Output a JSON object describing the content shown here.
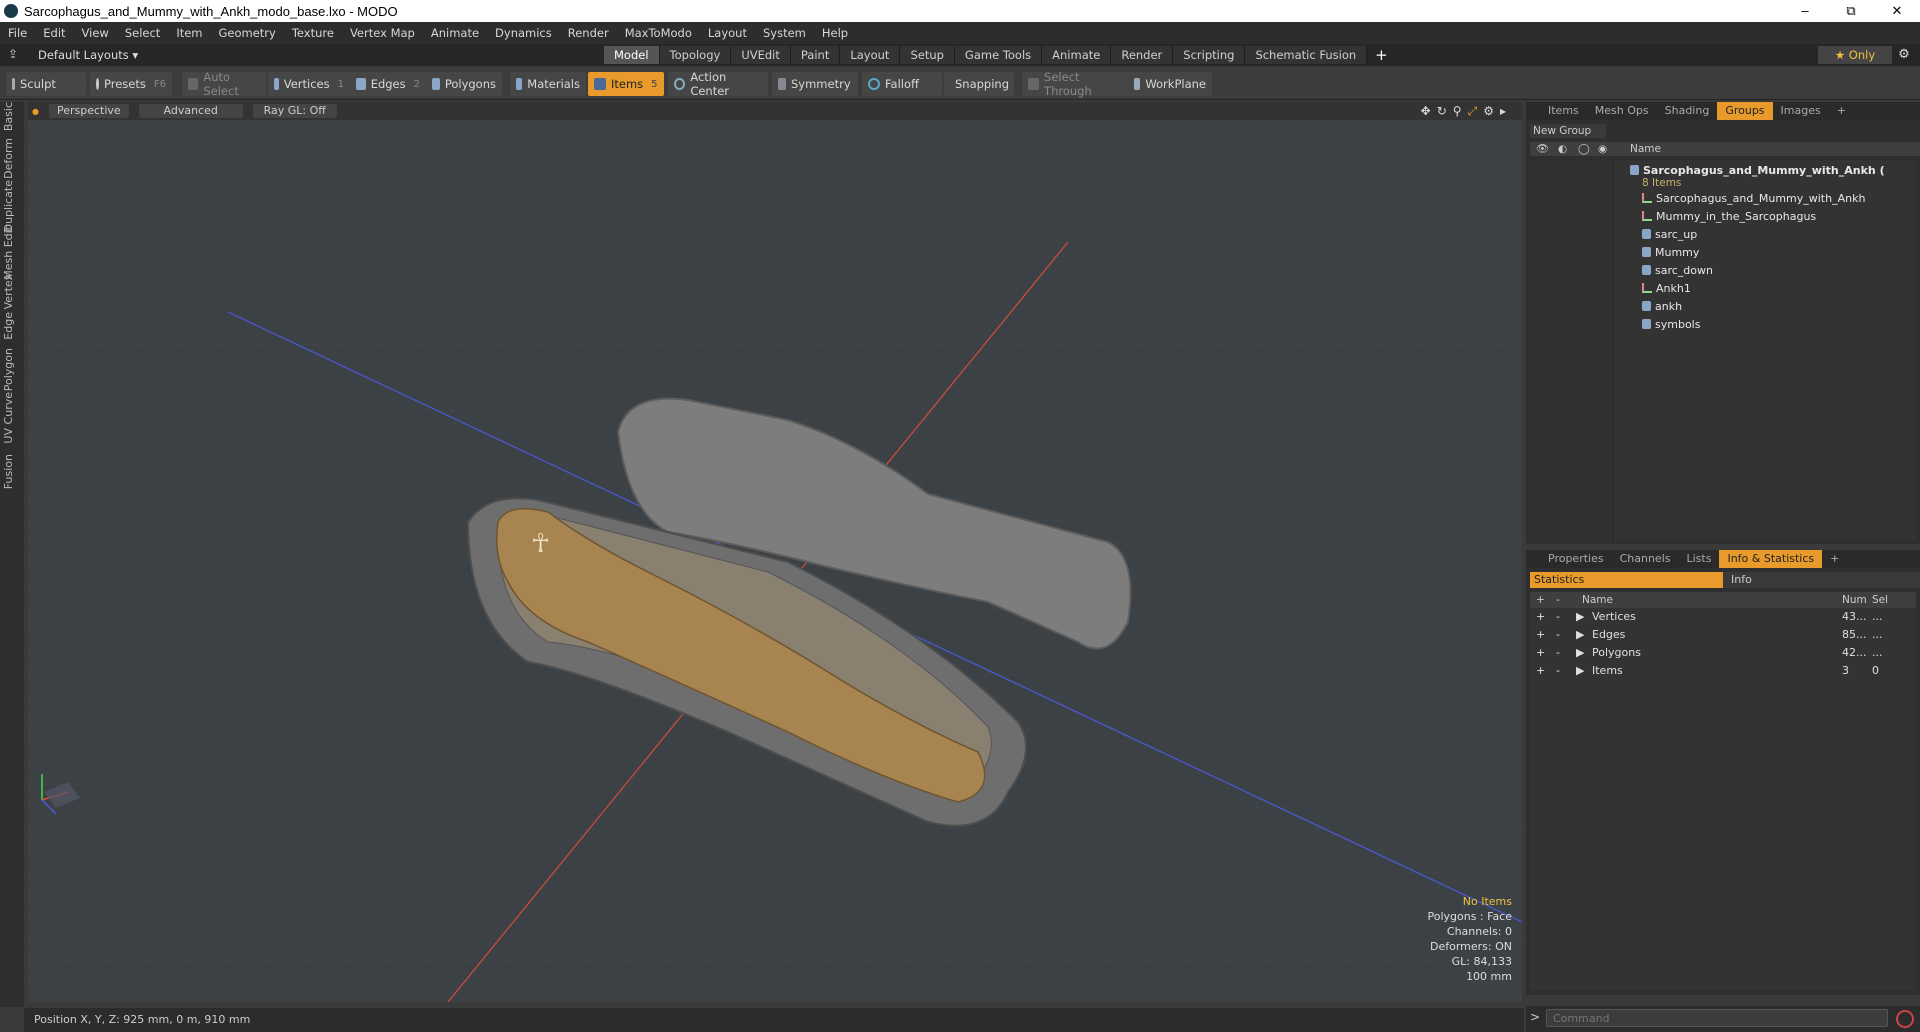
{
  "window": {
    "title": "Sarcophagus_and_Mummy_with_Ankh_modo_base.lxo - MODO",
    "minimize": "–",
    "maximize": "⧉",
    "close": "✕"
  },
  "menu": [
    "File",
    "Edit",
    "View",
    "Select",
    "Item",
    "Geometry",
    "Texture",
    "Vertex Map",
    "Animate",
    "Dynamics",
    "Render",
    "MaxToModo",
    "Layout",
    "System",
    "Help"
  ],
  "layouts": {
    "dropdown": "Default Layouts ▾",
    "only": "★  Only"
  },
  "layout_tabs": [
    "Model",
    "Topology",
    "UVEdit",
    "Paint",
    "Layout",
    "Setup",
    "Game Tools",
    "Animate",
    "Render",
    "Scripting",
    "Schematic Fusion"
  ],
  "toolbar": {
    "sculpt": "Sculpt",
    "presets": "Presets",
    "presets_key": "F6",
    "auto_select": "Auto Select",
    "vertices": "Vertices",
    "vertices_key": "1",
    "edges": "Edges",
    "edges_key": "2",
    "polygons": "Polygons",
    "materials": "Materials",
    "items": "Items",
    "items_key": "5",
    "action_center": "Action Center",
    "symmetry": "Symmetry",
    "falloff": "Falloff",
    "snapping": "Snapping",
    "select_through": "Select Through",
    "workplane": "WorkPlane"
  },
  "left_tabs": [
    "Basic",
    "Deform",
    "Duplicate",
    "Mesh Edit",
    "Vertex",
    "Edge",
    "Polygon",
    "Curve",
    "UV",
    "Fusion"
  ],
  "viewport": {
    "view_mode": "Perspective",
    "shading": "Advanced",
    "raygl": "Ray GL: Off",
    "info": {
      "items": "No Items",
      "polygons": "Polygons : Face",
      "channels": "Channels: 0",
      "deformers": "Deformers: ON",
      "gl": "GL: 84,133",
      "scale": "100 mm"
    }
  },
  "status": {
    "position": "Position X, Y, Z:  925 mm, 0 m, 910 mm"
  },
  "groups_panel": {
    "tabs": [
      "Items",
      "Mesh Ops",
      "Shading",
      "Groups",
      "Images"
    ],
    "new_group": "New Group",
    "name_header": "Name",
    "root": {
      "label": "Sarcophagus_and_Mummy_with_Ankh (",
      "sub": "8 Items"
    },
    "items": [
      {
        "label": "Sarcophagus_and_Mummy_with_Ankh",
        "kind": "locator"
      },
      {
        "label": "Mummy_in_the_Sarcophagus",
        "kind": "locator"
      },
      {
        "label": "sarc_up",
        "kind": "mesh"
      },
      {
        "label": "Mummy",
        "kind": "mesh"
      },
      {
        "label": "sarc_down",
        "kind": "mesh"
      },
      {
        "label": "Ankh1",
        "kind": "locator"
      },
      {
        "label": "ankh",
        "kind": "mesh"
      },
      {
        "label": "symbols",
        "kind": "mesh"
      }
    ]
  },
  "stats_panel": {
    "tabs": [
      "Properties",
      "Channels",
      "Lists",
      "Info & Statistics"
    ],
    "sub_tabs": [
      "Statistics",
      "Info"
    ],
    "headers": {
      "name": "Name",
      "num": "Num",
      "sel": "Sel"
    },
    "rows": [
      {
        "name": "Vertices",
        "num": "43...",
        "sel": "..."
      },
      {
        "name": "Edges",
        "num": "85...",
        "sel": "..."
      },
      {
        "name": "Polygons",
        "num": "42...",
        "sel": "..."
      },
      {
        "name": "Items",
        "num": "3",
        "sel": "0"
      }
    ]
  },
  "command": {
    "placeholder": "Command",
    "prompt": ">"
  }
}
